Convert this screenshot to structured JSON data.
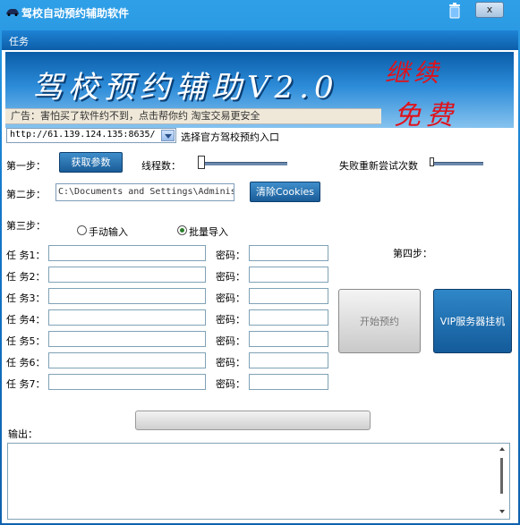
{
  "window": {
    "title": "驾校自动预约辅助软件",
    "close_label": "x"
  },
  "menu": {
    "items": [
      {
        "label": "任务"
      }
    ]
  },
  "banner": {
    "logo_text": "驾校预约辅助V2.0",
    "red_text_1": "继续",
    "red_text_2": "免费",
    "ticker": "广告：害怕买了软件约不到，点击帮你约   淘宝交易更安全"
  },
  "url": {
    "value": "http://61.139.124.135:8635/",
    "label": "选择官方驾校预约入口"
  },
  "step1": {
    "label": "第一步：",
    "button": "获取参数",
    "threads_label": "线程数：",
    "retry_label": "失败重新尝试次数"
  },
  "step2": {
    "label": "第二步：",
    "path_value": "C:\\Documents and Settings\\Adminis",
    "button": "清除Cookies"
  },
  "step3": {
    "label": "第三步：",
    "radio_manual": "手动输入",
    "radio_batch": "批量导入",
    "selected": "批量导入"
  },
  "step4": {
    "label": "第四步："
  },
  "tasks": [
    {
      "label": "任 务1：",
      "pwd_label": "密码："
    },
    {
      "label": "任 务2：",
      "pwd_label": "密码："
    },
    {
      "label": "任 务3：",
      "pwd_label": "密码："
    },
    {
      "label": "任 务4：",
      "pwd_label": "密码："
    },
    {
      "label": "任 务5：",
      "pwd_label": "密码："
    },
    {
      "label": "任 务6：",
      "pwd_label": "密码："
    },
    {
      "label": "任 务7：",
      "pwd_label": "密码："
    }
  ],
  "actions": {
    "start": "开始预约",
    "vip": "VIP服务器挂机"
  },
  "output": {
    "label": "输出："
  }
}
